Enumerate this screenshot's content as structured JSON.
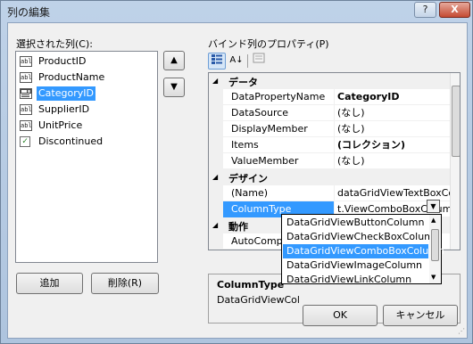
{
  "window": {
    "title": "列の編集",
    "help_label": "?",
    "close_label": "X"
  },
  "columns_panel": {
    "label": "選択された列(C):",
    "items": [
      {
        "icon": "abl",
        "label": "ProductID"
      },
      {
        "icon": "abl",
        "label": "ProductName"
      },
      {
        "icon": "combo",
        "label": "CategoryID",
        "selected": true
      },
      {
        "icon": "abl",
        "label": "SupplierID"
      },
      {
        "icon": "abl",
        "label": "UnitPrice"
      },
      {
        "icon": "check",
        "label": "Discontinued"
      }
    ],
    "move_up": "▲",
    "move_down": "▼",
    "add_label": "追加",
    "remove_label": "削除(R)"
  },
  "properties_panel": {
    "label": "バインド列のプロパティ(P)",
    "toolbar": {
      "categorized_icon": "categorized-icon",
      "alphabetical_icon": "sort-alphabetical-icon",
      "alphabetical_glyph": "A↓",
      "pages_icon": "property-pages-icon"
    },
    "categories": [
      {
        "name": "データ",
        "rows": [
          {
            "name": "DataPropertyName",
            "value": "CategoryID",
            "bold": true
          },
          {
            "name": "DataSource",
            "value": "(なし)"
          },
          {
            "name": "DisplayMember",
            "value": "(なし)"
          },
          {
            "name": "Items",
            "value": "(コレクション)",
            "bold": true
          },
          {
            "name": "ValueMember",
            "value": "(なし)"
          }
        ]
      },
      {
        "name": "デザイン",
        "rows": [
          {
            "name": "(Name)",
            "value": "dataGridViewTextBoxColum"
          },
          {
            "name": "ColumnType",
            "value": "t.ViewComboBoxColumn",
            "selected": true
          }
        ]
      },
      {
        "name": "動作",
        "rows": [
          {
            "name": "AutoComplete",
            "value": ""
          }
        ]
      }
    ],
    "dropdown_options": [
      "DataGridViewButtonColumn",
      "DataGridViewCheckBoxColumn",
      "DataGridViewComboBoxColumn",
      "DataGridViewImageColumn",
      "DataGridViewLinkColumn"
    ],
    "dropdown_selected_index": 2,
    "description": {
      "title": "ColumnType",
      "text": "DataGridViewCol"
    }
  },
  "footer": {
    "ok_label": "OK",
    "cancel_label": "キャンセル"
  },
  "colors": {
    "selection": "#3399ff",
    "chrome": "#bfd2e8",
    "client": "#f0f0f0"
  }
}
